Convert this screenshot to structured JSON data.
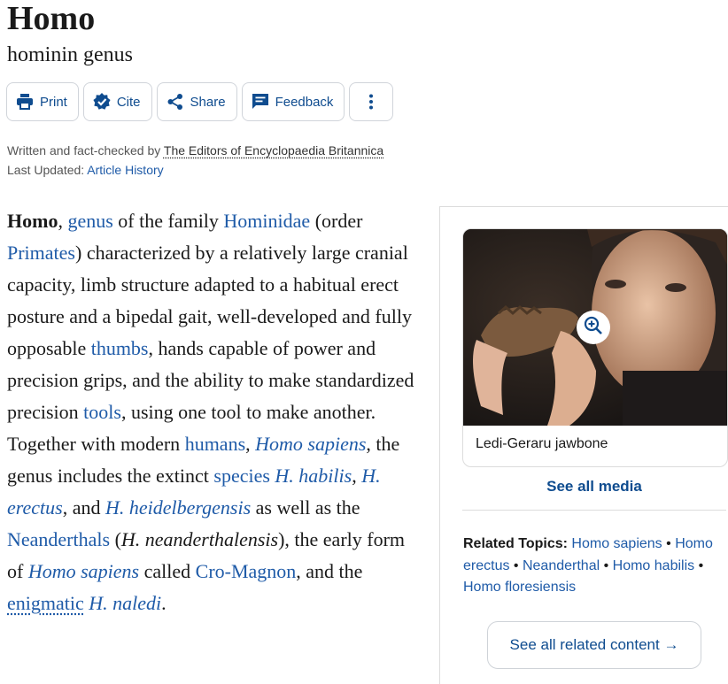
{
  "header": {
    "title": "Homo",
    "subtitle": "hominin genus"
  },
  "toolbar": {
    "print_label": "Print",
    "cite_label": "Cite",
    "share_label": "Share",
    "feedback_label": "Feedback"
  },
  "meta": {
    "written_by_prefix": "Written and fact-checked by",
    "editors": "The Editors of Encyclopaedia Britannica",
    "updated_prefix": "Last Updated:",
    "article_history": "Article History"
  },
  "article": {
    "t0": "Homo",
    "t1": ", ",
    "l_genus": "genus",
    "t2": " of the family ",
    "l_hominidae": "Hominidae",
    "t3": " (order ",
    "l_primates": "Primates",
    "t4": ") characterized by a relatively large cranial capacity, limb structure adapted to a habitual erect posture and a bipedal gait, well-developed and fully opposable ",
    "l_thumbs": "thumbs",
    "t5": ", hands capable of power and precision grips, and the ability to make standardized precision ",
    "l_tools": "tools",
    "t6": ", using one tool to make another. Together with modern ",
    "l_humans": "humans",
    "t7": ", ",
    "l_homo_sapiens": "Homo sapiens",
    "t8": ", the genus includes the extinct ",
    "l_species": "species",
    "t9": " ",
    "l_h_habilis": "H. habilis",
    "t10": ", ",
    "l_h_erectus": "H. erectus",
    "t11": ", and ",
    "l_h_heidelbergensis": "H. heidelbergensis",
    "t12": " as well as the ",
    "l_neanderthals": "Neanderthals",
    "t13": " (",
    "t_h_neander": "H. neanderthalensis",
    "t14": "), the early form of ",
    "l_homo_sapiens2": "Homo sapiens",
    "t15": " called ",
    "l_cromagnon": "Cro-Magnon",
    "t16": ", and the ",
    "l_enigmatic": "enigmatic",
    "t17": " ",
    "l_h_naledi": "H. naledi",
    "t18": "."
  },
  "sidebar": {
    "media_caption": "Ledi-Geraru jawbone",
    "see_all_media": "See all media",
    "related_label": "Related Topics:",
    "related_topics": [
      "Homo sapiens",
      "Homo erectus",
      "Neanderthal",
      "Homo habilis",
      "Homo floresiensis"
    ],
    "separator": " • ",
    "see_all_related": "See all related content →"
  },
  "colors": {
    "link": "#1f5ba8",
    "accent": "#0f4c8f",
    "border": "#d0d4da"
  }
}
